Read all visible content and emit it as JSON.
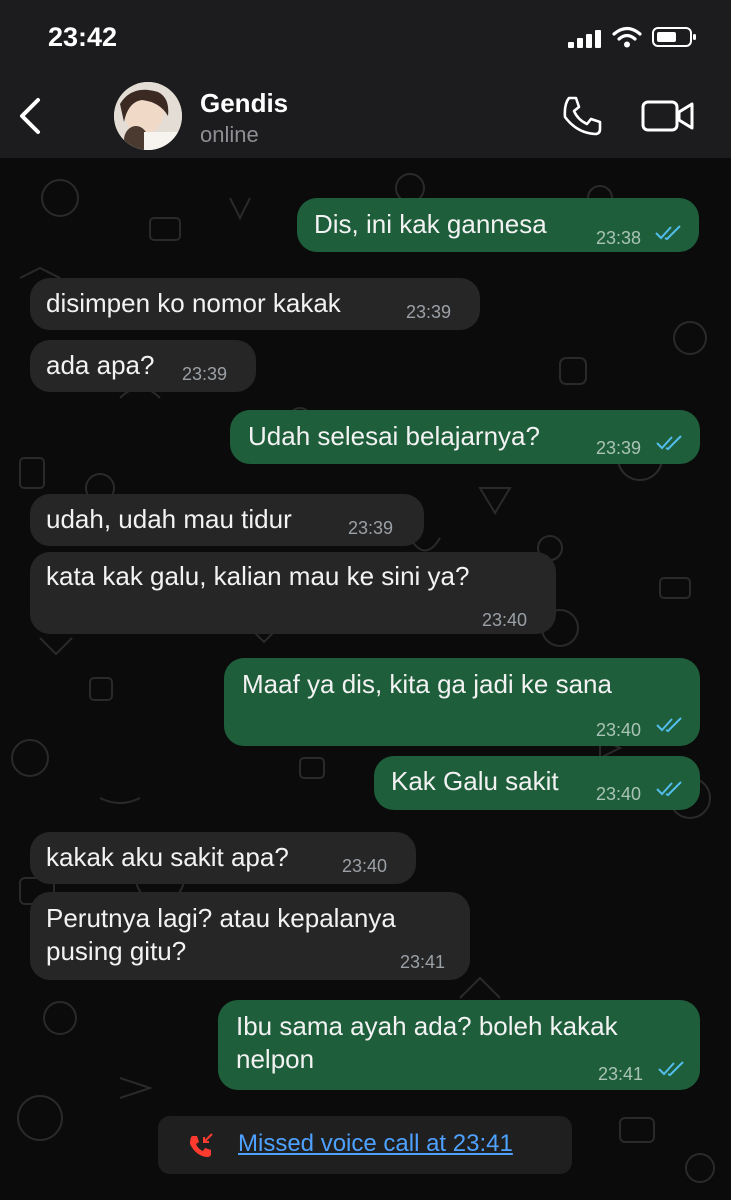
{
  "status_bar": {
    "time": "23:42"
  },
  "header": {
    "name": "Gendis",
    "status": "online"
  },
  "messages": [
    {
      "dir": "out",
      "text": "Dis, ini kak gannesa",
      "time": "23:38"
    },
    {
      "dir": "in",
      "text": "disimpen ko nomor kakak",
      "time": "23:39"
    },
    {
      "dir": "in",
      "text": "ada apa?",
      "time": "23:39"
    },
    {
      "dir": "out",
      "text": "Udah selesai belajarnya?",
      "time": "23:39"
    },
    {
      "dir": "in",
      "text": "udah, udah mau tidur",
      "time": "23:39"
    },
    {
      "dir": "in",
      "text": "kata kak galu, kalian mau ke sini ya?",
      "time": "23:40"
    },
    {
      "dir": "out",
      "text": "Maaf ya dis, kita ga jadi ke sana",
      "time": "23:40"
    },
    {
      "dir": "out",
      "text": "Kak Galu sakit",
      "time": "23:40"
    },
    {
      "dir": "in",
      "text": "kakak aku sakit apa?",
      "time": "23:40"
    },
    {
      "dir": "in",
      "text": "Perutnya lagi? atau kepalanya\npusing gitu?",
      "time": "23:41"
    },
    {
      "dir": "out",
      "text": "Ibu sama ayah ada? boleh kakak\nnelpon",
      "time": "23:41"
    }
  ],
  "missed_call": {
    "text": "Missed voice call at 23:41"
  },
  "colors": {
    "outgoing_bubble": "#1e5e3b",
    "incoming_bubble": "#262626",
    "read_ticks": "#53bdeb",
    "missed_call_icon": "#ff3b30",
    "link": "#4ea1ff"
  },
  "icons": [
    "back-chevron-icon",
    "phone-icon",
    "video-camera-icon",
    "double-check-icon",
    "missed-call-icon"
  ]
}
